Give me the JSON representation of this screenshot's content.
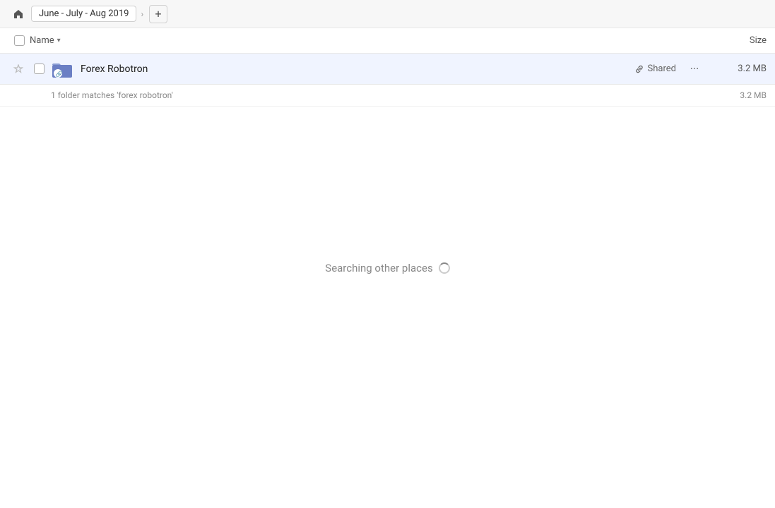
{
  "topbar": {
    "home_label": "home",
    "breadcrumb_label": "June - July - Aug 2019",
    "add_tab_label": "+"
  },
  "columns": {
    "name_label": "Name",
    "size_label": "Size"
  },
  "file_row": {
    "name": "Forex Robotron",
    "shared_label": "Shared",
    "size": "3.2 MB",
    "more_dots": "···"
  },
  "match_info": {
    "text": "1 folder matches 'forex robotron'",
    "size": "3.2 MB"
  },
  "searching": {
    "label": "Searching other places"
  },
  "colors": {
    "row_bg": "#f0f4ff",
    "accent": "#5b7fd4"
  }
}
